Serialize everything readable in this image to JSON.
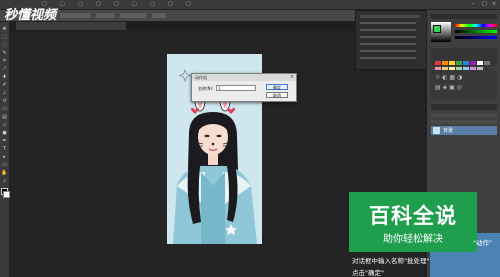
{
  "watermark": {
    "logo_text": "秒懂视频"
  },
  "menubar": {
    "items": [
      "",
      "",
      "",
      "",
      "",
      "",
      "",
      "",
      "",
      "",
      ""
    ]
  },
  "document": {
    "tab_label": ""
  },
  "dialog": {
    "title": "动作组",
    "field_label": "名称(N):",
    "field_value": "1",
    "ok_label": "确定",
    "cancel_label": "取消"
  },
  "brand": {
    "title": "百科全说",
    "subtitle": "助你轻松解决"
  },
  "captions": {
    "line1": "\"动作\"",
    "line2": "对话框中输入名称\"批处理\"",
    "line3": "点击\"确定\""
  },
  "layers": {
    "layer_name": "背景"
  },
  "colors": {
    "accent": "#1f9e4e",
    "dialog_bg": "#ececec",
    "workspace": "#242424"
  }
}
